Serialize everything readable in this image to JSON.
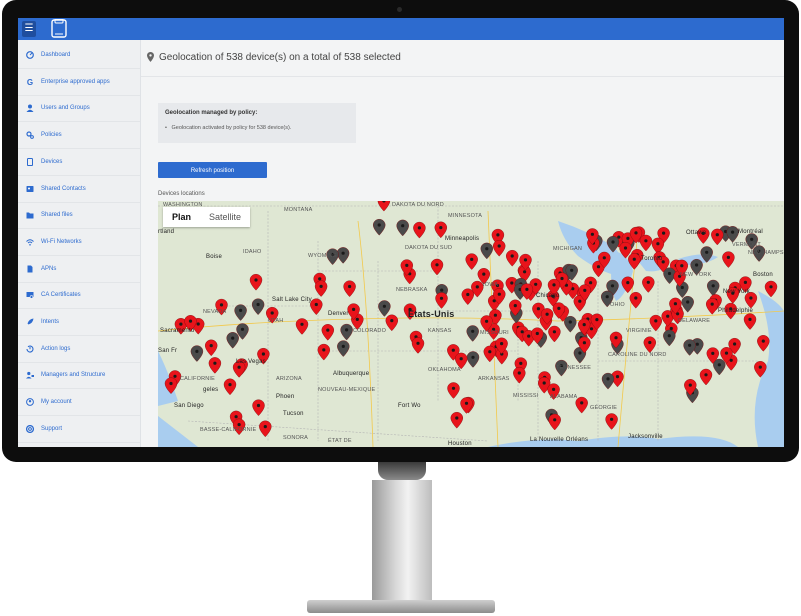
{
  "header": {
    "menu_icon": "menu-toggle-icon",
    "logo": "phone-logo-icon"
  },
  "sidebar": {
    "items": [
      {
        "label": "Dashboard",
        "icon": "dashboard-icon"
      },
      {
        "label": "Enterprise approved apps",
        "icon": "google-icon"
      },
      {
        "label": "Users and Groups",
        "icon": "user-icon"
      },
      {
        "label": "Policies",
        "icon": "gears-icon"
      },
      {
        "label": "Devices",
        "icon": "device-icon"
      },
      {
        "label": "Shared Contacts",
        "icon": "contacts-icon"
      },
      {
        "label": "Shared files",
        "icon": "files-icon"
      },
      {
        "label": "Wi-Fi Networks",
        "icon": "wifi-icon"
      },
      {
        "label": "APNs",
        "icon": "sim-icon"
      },
      {
        "label": "CA Certificates",
        "icon": "certificate-icon"
      },
      {
        "label": "Intents",
        "icon": "rocket-icon"
      },
      {
        "label": "Action logs",
        "icon": "history-icon"
      },
      {
        "label": "Managers and Structure",
        "icon": "managers-icon"
      },
      {
        "label": "My account",
        "icon": "account-icon"
      },
      {
        "label": "Support",
        "icon": "support-icon"
      }
    ]
  },
  "main": {
    "title": "Geolocation of 538 device(s) on a total of 538 selected",
    "policy_box": {
      "heading": "Geolocation managed by policy:",
      "item": "Geolocation activated by policy for 538 device(s)."
    },
    "refresh_button": "Refresh position",
    "map_section_label": "Devices locations",
    "map": {
      "tabs": [
        "Plan",
        "Satellite"
      ],
      "active_tab": "Plan",
      "labels": {
        "washington": "WASHINGTON",
        "montana": "MONTANA",
        "dakota_nord": "DAKOTA DU NORD",
        "minnesota": "MINNESOTA",
        "ottawa": "Ottawa",
        "montreal": "Montréal",
        "portland": "rtland",
        "boise": "Boise",
        "idaho": "IDAHO",
        "dakota_sud": "DAKOTA DU SUD",
        "wyoming": "WYOMING",
        "minneapolis": "Minneapolis",
        "michigan": "MICHIGAN",
        "toronto": "Toronto",
        "vermont": "VERMONT",
        "nh": "NEW HAMPSHIRE",
        "boston": "Boston",
        "ny": "NEW YORK",
        "iowa": "IOWA",
        "nebraska": "NEBRASKA",
        "chicago": "Chicago",
        "ohio": "OHIO",
        "nevada": "NEVADA",
        "slc": "Salt Lake City",
        "utah": "UTAH",
        "denver": "Denver",
        "etats": "États-Unis",
        "colorado": "COLORADO",
        "kansas": "KANSAS",
        "missouri": "MISSOURI",
        "newyork": "New York",
        "philadelphia": "Philadelphie",
        "virginia": "VIRGINIE",
        "delaware": "DELAWARE",
        "sacramento": "Sacramento",
        "sanfran": "San Fr",
        "lasvegas": "Las Vegas",
        "california": "CALIFORNIE",
        "arizona": "ARIZONA",
        "oklahoma": "OKLAHOMA",
        "tennessee": "TENNESSEE",
        "carolina": "CAROLINE DU NORD",
        "los_angeles": "geles",
        "albuquerque": "Albuquerque",
        "nm": "NOUVEAU-MEXIQUE",
        "arkansas": "ARKANSAS",
        "mississippi": "MISSISSI",
        "alabama": "ALABAMA",
        "georgia": "GÉORGIE",
        "sandiego": "San Diego",
        "phoenix": "Phoen",
        "tucson": "Tucson",
        "fortworth": "Fort Wo",
        "baja": "BASSE-CALIFORNIE",
        "sonora": "SONORA",
        "texas": "ÉTAT DE",
        "neworleans": "La Nouvelle Orléans",
        "jacksonville": "Jacksonville",
        "houston": "Houston"
      }
    }
  },
  "colors": {
    "accent": "#2d6bcf",
    "pin_red": "#e8141b",
    "pin_grey": "#4a4a4a",
    "map_land": "#dfe7d3",
    "water": "#a9cdef"
  }
}
